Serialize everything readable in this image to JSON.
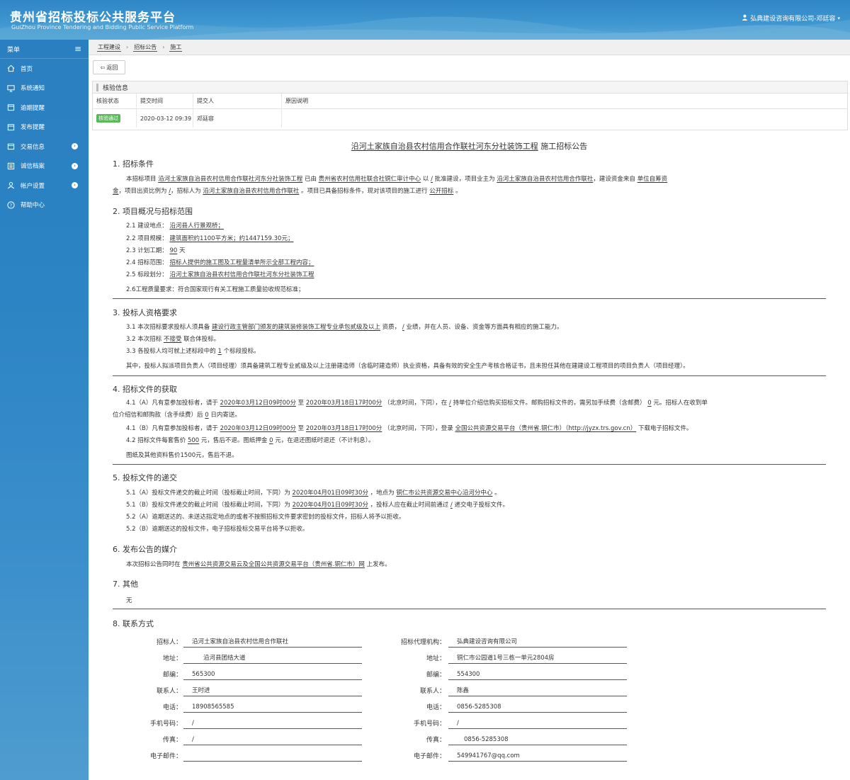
{
  "header": {
    "title": "贵州省招标投标公共服务平台",
    "subtitle": "GuiZhou Province Tendering and Bidding Public Service Platform",
    "user": "弘典建设咨询有限公司-邓廷容"
  },
  "sidebar": {
    "menu_label": "菜单",
    "items": [
      {
        "label": "首页"
      },
      {
        "label": "系统通知"
      },
      {
        "label": "逾期提醒"
      },
      {
        "label": "发布提醒"
      },
      {
        "label": "交易信息"
      },
      {
        "label": "诚信档案"
      },
      {
        "label": "帐户设置"
      },
      {
        "label": "帮助中心"
      }
    ]
  },
  "breadcrumb": [
    "工程建设",
    "招标公告",
    "施工"
  ],
  "back_label": "返回",
  "verify": {
    "title": "核验信息",
    "headers": [
      "核验状态",
      "提交时间",
      "提交人",
      "原因说明"
    ],
    "row": {
      "status": "核验通过",
      "time": "2020-03-12 09:39",
      "person": "邓廷容",
      "reason": ""
    }
  },
  "notice": {
    "project_name": "沿河土家族自治县农村信用合作联社河东分社装饰工程",
    "title_suffix": "施工招标公告",
    "s1": {
      "head": "1. 招标条件",
      "l1": {
        "a": "本招标项目",
        "project": "沿河土家族自治县农村信用合作联社河东分社装饰工程",
        "b": "已由",
        "approver": "贵州省农村信用社联合社铜仁审计中心",
        "c": "以",
        "doc": "/",
        "d": "批准建设，项目业主为",
        "owner": "沿河土家族自治县农村信用合作联社",
        "e": "，建设资金来自",
        "fund1": "单位自筹资"
      },
      "l2": {
        "fund2": "金",
        "a": "，项目出资比例为",
        "ratio": "/",
        "b": "，招标人为",
        "tenderer": "沿河土家族自治县农村信用合作联社",
        "c": "。项目已具备招标条件，现对该项目的施工进行",
        "method": "公开招标",
        "d": "。"
      }
    },
    "s2": {
      "head": "2. 项目概况与招标范围",
      "l1": {
        "a": "2.1 建设地点：",
        "v": "沿河县人行景观桥；"
      },
      "l2": {
        "a": "2.2 项目规模：",
        "v": "建筑面积约1100平方米；约1447159.30元；"
      },
      "l3": {
        "a": "2.3 计划工期：",
        "v": "90",
        "b": "天"
      },
      "l4": {
        "a": "2.4 招标范围：",
        "v": "招标人提供的施工图及工程量清单所示全部工程内容；"
      },
      "l5": {
        "a": "2.5 标段划分：",
        "v": "沿河土家族自治县农村信用合作联社河东分社装饰工程"
      },
      "l6": "2.6工程质量要求：符合国家现行有关工程施工质量验收规范标准；"
    },
    "s3": {
      "head": "3. 投标人资格要求",
      "l1": {
        "a": "3.1 本次招标要求投标人须具备",
        "v": "建设行政主管部门颁发的建筑装修装饰工程专业承包贰级及以上",
        "b": "资质，",
        "v2": "/",
        "c": "业绩，并在人员、设备、资金等方面具有相应的施工能力。"
      },
      "l2": {
        "a": "3.2 本次招标",
        "v": "不接受",
        "b": "联合体投标。"
      },
      "l3": {
        "a": "3.3 各投标人均可就上述标段中的",
        "v": "1",
        "b": "个标段投标。"
      },
      "l4": "其中，投标人拟派项目负责人（项目经理）须具备建筑工程专业贰级及以上注册建造师（含临时建造师）执业资格，具备有效的安全生产考核合格证书，且未担任其他在建建设工程项目的项目负责人（项目经理）。"
    },
    "s4": {
      "head": "4. 招标文件的获取",
      "l1": {
        "a": "4.1（A）凡有意参加投标者，请于",
        "start": "2020年03月12日09时00分",
        "b": "至",
        "end": "2020年03月18日17时00分",
        "c": "（北京时间，下同），在",
        "place": "/",
        "d": "持单位介绍信购买招标文件。邮购招标文件的，需另加手续费（含邮费）",
        "fee": "0",
        "e": "元。招标人在收到单"
      },
      "l1b": {
        "a": "位介绍信和邮购款（含手续费）后",
        "days": "0",
        "b": "日内寄送。"
      },
      "l2": {
        "a": "4.1（B）凡有意参加投标者，请于",
        "start": "2020年03月12日09时00分",
        "b": "至",
        "end": "2020年03月18日17时00分",
        "c": "（北京时间，下同），登录",
        "site": "全国公共资源交易平台（贵州省.铜仁市）（http://jyzx.trs.gov.cn）",
        "d": "下载电子招标文件。"
      },
      "l3": {
        "a": "4.2 招标文件每套售价",
        "price": "500",
        "b": "元，售后不退。图纸押金",
        "deposit": "0",
        "c": "元，在退还图纸时退还（不计利息）。"
      },
      "l4": "图纸及其他资料售价1500元，售后不退。"
    },
    "s5": {
      "head": "5. 投标文件的递交",
      "l1": {
        "a": "5.1（A）投标文件递交的截止时间（投标截止时间，下同）为",
        "time": "2020年04月01日09时30分",
        "b": "，地点为",
        "place": "铜仁市公共资源交易中心沿河分中心",
        "c": "。"
      },
      "l2": {
        "a": "5.1（B）投标文件递交的截止时间（投标截止时间，下同）为",
        "time": "2020年04月01日09时30分",
        "b": "，投标人应在截止时间前通过",
        "via": "/",
        "c": "递交电子投标文件。"
      },
      "l3": "5.2（A）逾期送达的、未送达指定地点的或者不按照招标文件要求密封的投标文件，招标人将予以拒收。",
      "l4": "5.2（B）逾期送达的投标文件，电子招标投标交易平台将予以拒收。"
    },
    "s6": {
      "head": "6. 发布公告的媒介",
      "l1": {
        "a": "本次招标公告同时在",
        "v": "贵州省公共资源交易云及全国公共资源交易平台（贵州省.铜仁市）网",
        "b": "上发布。"
      }
    },
    "s7": {
      "head": "7. 其他",
      "l1": "无"
    },
    "s8": {
      "head": "8. 联系方式",
      "left": [
        {
          "label": "招标人：",
          "value": "沿河土家族自治县农村信用合作联社"
        },
        {
          "label": "地址：",
          "value": "沿河县团结大道"
        },
        {
          "label": "邮编：",
          "value": "565300"
        },
        {
          "label": "联系人：",
          "value": "王时进"
        },
        {
          "label": "电话：",
          "value": "18908565585"
        },
        {
          "label": "手机号码：",
          "value": "/"
        },
        {
          "label": "传真：",
          "value": "/"
        },
        {
          "label": "电子邮件：",
          "value": ""
        }
      ],
      "right": [
        {
          "label": "招标代理机构：",
          "value": "弘典建设咨询有限公司"
        },
        {
          "label": "地址：",
          "value": "铜仁市公园道1号三栋一单元2804房"
        },
        {
          "label": "邮编：",
          "value": "554300"
        },
        {
          "label": "联系人：",
          "value": "陈鑫"
        },
        {
          "label": "电话：",
          "value": "0856-5285308"
        },
        {
          "label": "手机号码：",
          "value": "/"
        },
        {
          "label": "传真：",
          "value": "0856-5285308"
        },
        {
          "label": "电子邮件：",
          "value": "549941767@qq.com"
        }
      ]
    }
  }
}
